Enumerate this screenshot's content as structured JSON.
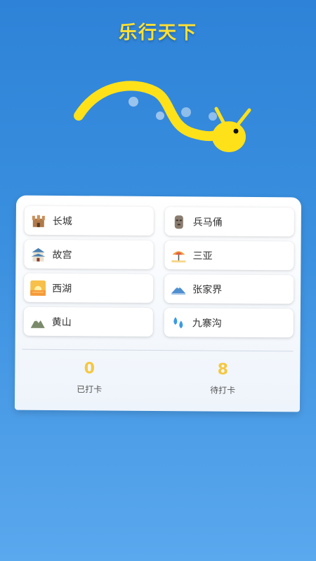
{
  "app": {
    "title": "乐行天下"
  },
  "spots": [
    {
      "label": "长城",
      "icon": "castle-icon",
      "color": "#b07a4a"
    },
    {
      "label": "兵马俑",
      "icon": "moai-statue-icon",
      "color": "#8a7d70"
    },
    {
      "label": "故宫",
      "icon": "palace-icon",
      "color": "#4a7fb0"
    },
    {
      "label": "三亚",
      "icon": "beach-umbrella-icon",
      "color": "#f0a040"
    },
    {
      "label": "西湖",
      "icon": "sunrise-icon",
      "color": "#f59a3a"
    },
    {
      "label": "张家界",
      "icon": "snowy-mountain-icon",
      "color": "#4f8fd0"
    },
    {
      "label": "黄山",
      "icon": "mountain-icon",
      "color": "#7b8a6a"
    },
    {
      "label": "九寨沟",
      "icon": "water-droplets-icon",
      "color": "#3a9be0"
    }
  ],
  "stats": {
    "checked_in": {
      "value": "0",
      "label": "已打卡"
    },
    "pending": {
      "value": "8",
      "label": "待打卡"
    }
  },
  "colors": {
    "accent": "#ffe033",
    "stat": "#f5c842",
    "snake": "#ffe11a"
  }
}
